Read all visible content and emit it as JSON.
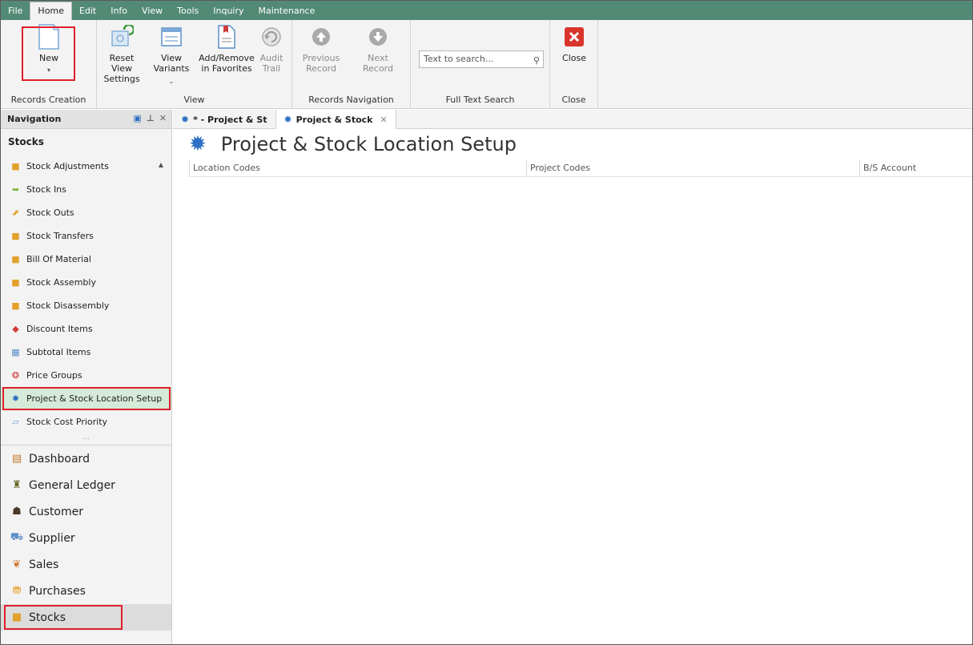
{
  "menu": [
    "File",
    "Home",
    "Edit",
    "Info",
    "View",
    "Tools",
    "Inquiry",
    "Maintenance"
  ],
  "ribbon": {
    "new_label": "New",
    "records_creation_caption": "Records Creation",
    "reset_view_label": "Reset View Settings",
    "view_variants_label": "View Variants",
    "add_remove_favorites_label": "Add/Remove in Favorites",
    "audit_trail_label": "Audit Trail",
    "view_caption": "View",
    "previous_record_label": "Previous Record",
    "next_record_label": "Next Record",
    "records_navigation_caption": "Records Navigation",
    "search_placeholder": "Text to search...",
    "full_text_search_caption": "Full Text Search",
    "close_label": "Close",
    "close_caption": "Close"
  },
  "navigation": {
    "header": "Navigation",
    "section": "Stocks",
    "items": [
      {
        "label": "Stock Adjustments",
        "icon": "box-icon"
      },
      {
        "label": "Stock Ins",
        "icon": "stock-in-icon"
      },
      {
        "label": "Stock Outs",
        "icon": "stock-out-icon"
      },
      {
        "label": "Stock Transfers",
        "icon": "box-icon"
      },
      {
        "label": "Bill Of Material",
        "icon": "box-icon"
      },
      {
        "label": "Stock Assembly",
        "icon": "box-icon"
      },
      {
        "label": "Stock Disassembly",
        "icon": "box-icon"
      },
      {
        "label": "Discount Items",
        "icon": "tag-icon"
      },
      {
        "label": "Subtotal Items",
        "icon": "calculator-icon"
      },
      {
        "label": "Price Groups",
        "icon": "price-groups-icon"
      },
      {
        "label": "Project & Stock Location Setup",
        "icon": "gear-icon"
      },
      {
        "label": "Stock Cost Priority",
        "icon": "chart-icon"
      }
    ],
    "dots": "...",
    "modules": [
      {
        "label": "Dashboard",
        "icon": "dashboard-icon"
      },
      {
        "label": "General Ledger",
        "icon": "ledger-icon"
      },
      {
        "label": "Customer",
        "icon": "customer-icon"
      },
      {
        "label": "Supplier",
        "icon": "supplier-icon"
      },
      {
        "label": "Sales",
        "icon": "sales-icon"
      },
      {
        "label": "Purchases",
        "icon": "purchases-icon"
      },
      {
        "label": "Stocks",
        "icon": "stocks-icon"
      }
    ]
  },
  "tabs": [
    {
      "label": "* - Project & St"
    },
    {
      "label": "Project & Stock"
    }
  ],
  "content": {
    "title": "Project & Stock Location Setup",
    "columns": [
      "Location Codes",
      "Project Codes",
      "B/S Account"
    ]
  },
  "colors": {
    "menubar": "#538a75",
    "highlight": "#e0202a",
    "selected": "#d6ead9"
  }
}
